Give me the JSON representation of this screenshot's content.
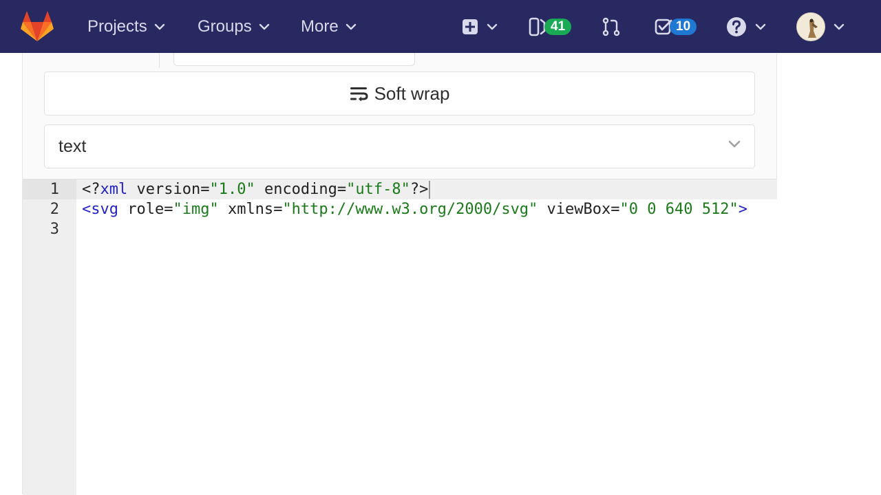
{
  "navbar": {
    "projects_label": "Projects",
    "groups_label": "Groups",
    "more_label": "More",
    "issues_count": "41",
    "todos_count": "10",
    "colors": {
      "background": "#292961",
      "issues_badge": "#1aaa55",
      "todos_badge": "#1f78d1"
    }
  },
  "toolbar": {
    "soft_wrap_label": "Soft wrap"
  },
  "mode_select": {
    "value": "text"
  },
  "editor": {
    "line_numbers": [
      "1",
      "2",
      "3"
    ],
    "lines": [
      {
        "tokens": [
          {
            "t": "<?",
            "c": "plain"
          },
          {
            "t": "xml",
            "c": "tag"
          },
          {
            "t": " version",
            "c": "plain"
          },
          {
            "t": "=",
            "c": "plain"
          },
          {
            "t": "\"1.0\"",
            "c": "str"
          },
          {
            "t": " encoding",
            "c": "plain"
          },
          {
            "t": "=",
            "c": "plain"
          },
          {
            "t": "\"utf-8\"",
            "c": "str"
          },
          {
            "t": "?>",
            "c": "plain"
          }
        ]
      },
      {
        "tokens": [
          {
            "t": "<svg",
            "c": "tag"
          },
          {
            "t": " role",
            "c": "plain"
          },
          {
            "t": "=",
            "c": "plain"
          },
          {
            "t": "\"img\"",
            "c": "str"
          },
          {
            "t": " xmlns",
            "c": "plain"
          },
          {
            "t": "=",
            "c": "plain"
          },
          {
            "t": "\"http://www.w3.org/2000/svg\"",
            "c": "str"
          },
          {
            "t": " viewBox",
            "c": "plain"
          },
          {
            "t": "=",
            "c": "plain"
          },
          {
            "t": "\"0 0 640 512\"",
            "c": "str"
          },
          {
            "t": ">",
            "c": "tag"
          }
        ]
      },
      {
        "tokens": []
      }
    ]
  }
}
